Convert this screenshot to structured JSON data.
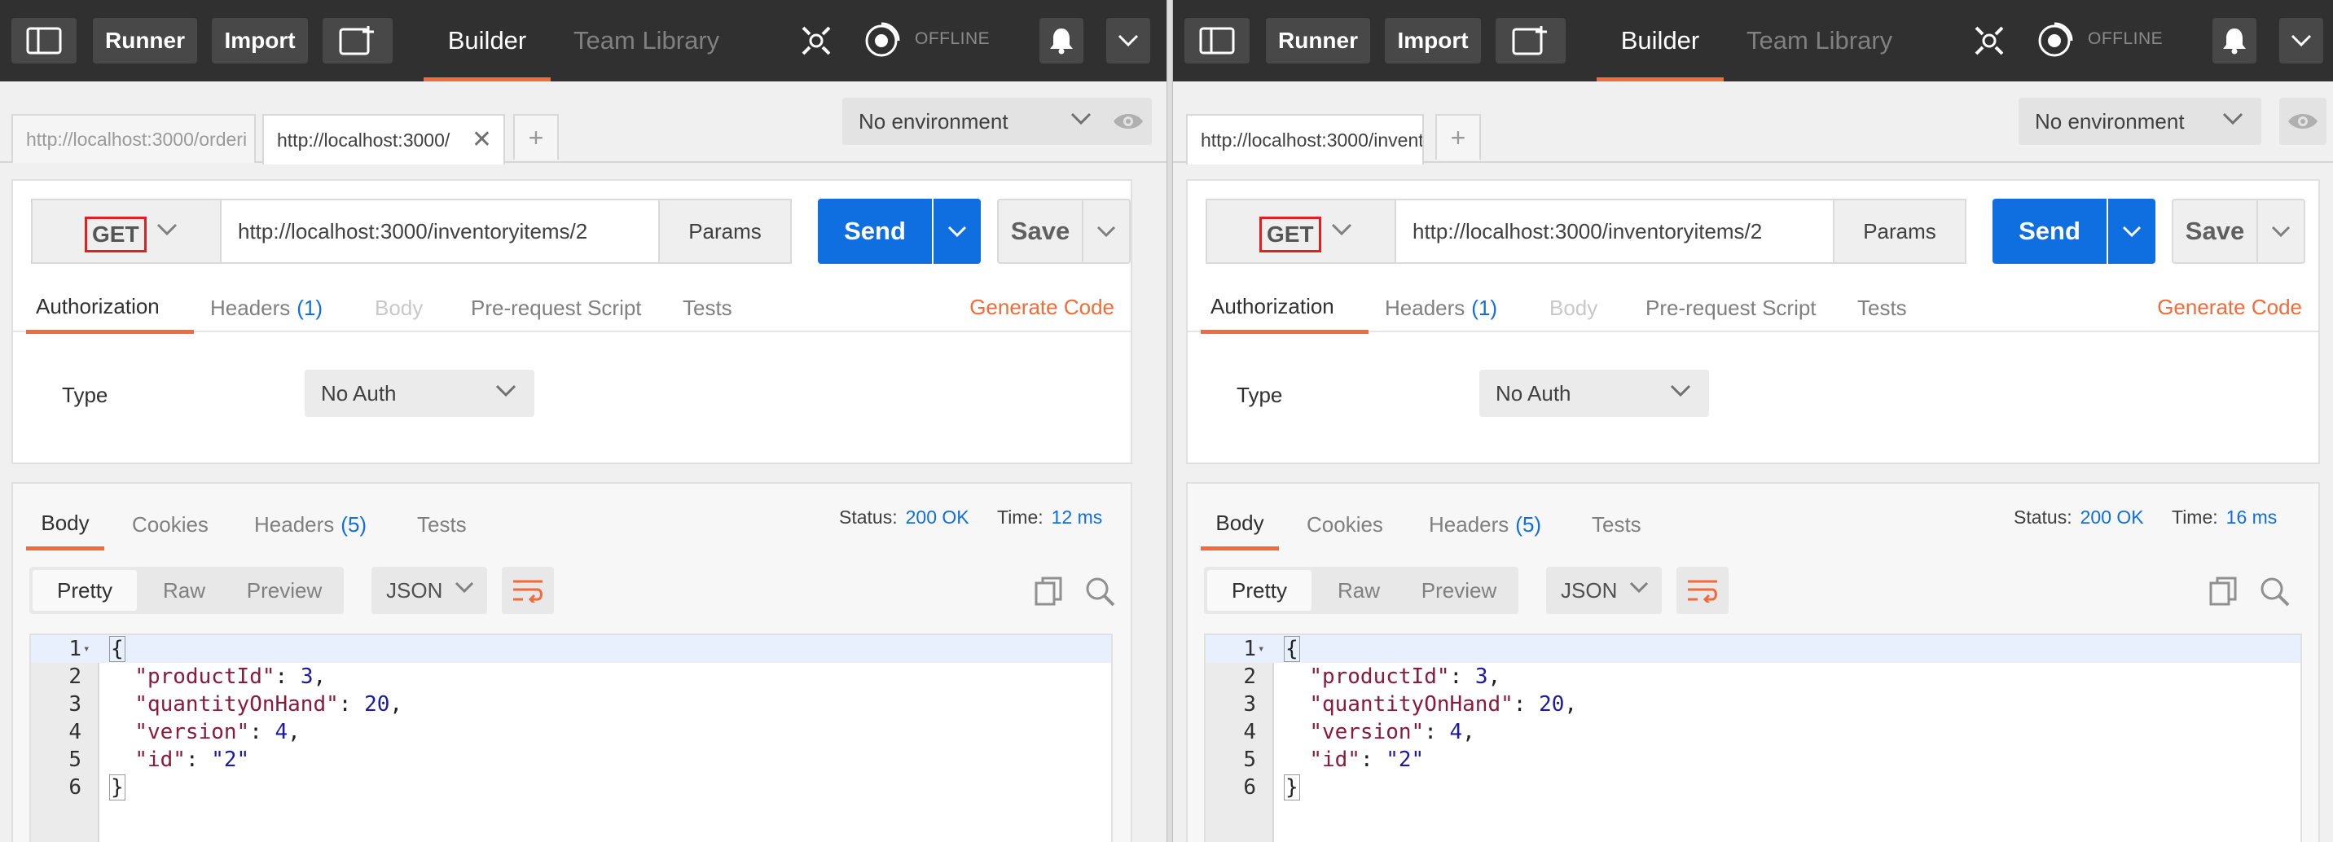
{
  "colors": {
    "topbar_bg": "#303030",
    "accent_orange": "#f26b3a",
    "send_blue": "#0f6fe0",
    "highlight_red": "#e02020"
  },
  "topbar": {
    "sidebar_icon": "sidebar-toggle-icon",
    "runner_label": "Runner",
    "import_label": "Import",
    "new_window_icon": "new-window-icon",
    "builder_label": "Builder",
    "team_library_label": "Team Library",
    "sync_icon": "satellite-sync-icon",
    "interceptor_icon": "interceptor-icon",
    "offline_label": "OFFLINE",
    "bell_icon": "bell-icon",
    "menu_icon": "chevron-down-icon"
  },
  "left": {
    "tabs": [
      {
        "label": "http://localhost:3000/orderi",
        "active": false
      },
      {
        "label": "http://localhost:3000/",
        "active": true
      }
    ],
    "environment": "No environment",
    "request": {
      "method": "GET",
      "url": "http://localhost:3000/inventoryitems/2",
      "params_label": "Params",
      "send_label": "Send",
      "save_label": "Save",
      "tabs": {
        "authorization": "Authorization",
        "headers": "Headers",
        "headers_count": "(1)",
        "body": "Body",
        "prerequest": "Pre-request Script",
        "tests": "Tests"
      },
      "generate_code": "Generate Code",
      "auth_type_label": "Type",
      "auth_type_value": "No Auth"
    },
    "response": {
      "tabs": {
        "body": "Body",
        "cookies": "Cookies",
        "headers": "Headers",
        "headers_count": "(5)",
        "tests": "Tests"
      },
      "status_label": "Status:",
      "status_value": "200 OK",
      "time_label": "Time:",
      "time_value": "12 ms",
      "views": [
        "Pretty",
        "Raw",
        "Preview"
      ],
      "format": "JSON",
      "code_lines": [
        {
          "n": "1",
          "text": "{"
        },
        {
          "n": "2",
          "key": "\"productId\"",
          "value": "3"
        },
        {
          "n": "3",
          "key": "\"quantityOnHand\"",
          "value": "20"
        },
        {
          "n": "4",
          "key": "\"version\"",
          "value": "4"
        },
        {
          "n": "5",
          "key": "\"id\"",
          "value": "\"2\""
        },
        {
          "n": "6",
          "text": "}"
        }
      ]
    }
  },
  "right": {
    "tabs": [
      {
        "label": "http://localhost:3000/invent",
        "active": true
      }
    ],
    "environment": "No environment",
    "request": {
      "method": "GET",
      "url": "http://localhost:3000/inventoryitems/2",
      "params_label": "Params",
      "send_label": "Send",
      "save_label": "Save",
      "tabs": {
        "authorization": "Authorization",
        "headers": "Headers",
        "headers_count": "(1)",
        "body": "Body",
        "prerequest": "Pre-request Script",
        "tests": "Tests"
      },
      "generate_code": "Generate Code",
      "auth_type_label": "Type",
      "auth_type_value": "No Auth"
    },
    "response": {
      "tabs": {
        "body": "Body",
        "cookies": "Cookies",
        "headers": "Headers",
        "headers_count": "(5)",
        "tests": "Tests"
      },
      "status_label": "Status:",
      "status_value": "200 OK",
      "time_label": "Time:",
      "time_value": "16 ms",
      "views": [
        "Pretty",
        "Raw",
        "Preview"
      ],
      "format": "JSON",
      "code_lines": [
        {
          "n": "1",
          "text": "{"
        },
        {
          "n": "2",
          "key": "\"productId\"",
          "value": "3"
        },
        {
          "n": "3",
          "key": "\"quantityOnHand\"",
          "value": "20"
        },
        {
          "n": "4",
          "key": "\"version\"",
          "value": "4"
        },
        {
          "n": "5",
          "key": "\"id\"",
          "value": "\"2\""
        },
        {
          "n": "6",
          "text": "}"
        }
      ]
    }
  }
}
